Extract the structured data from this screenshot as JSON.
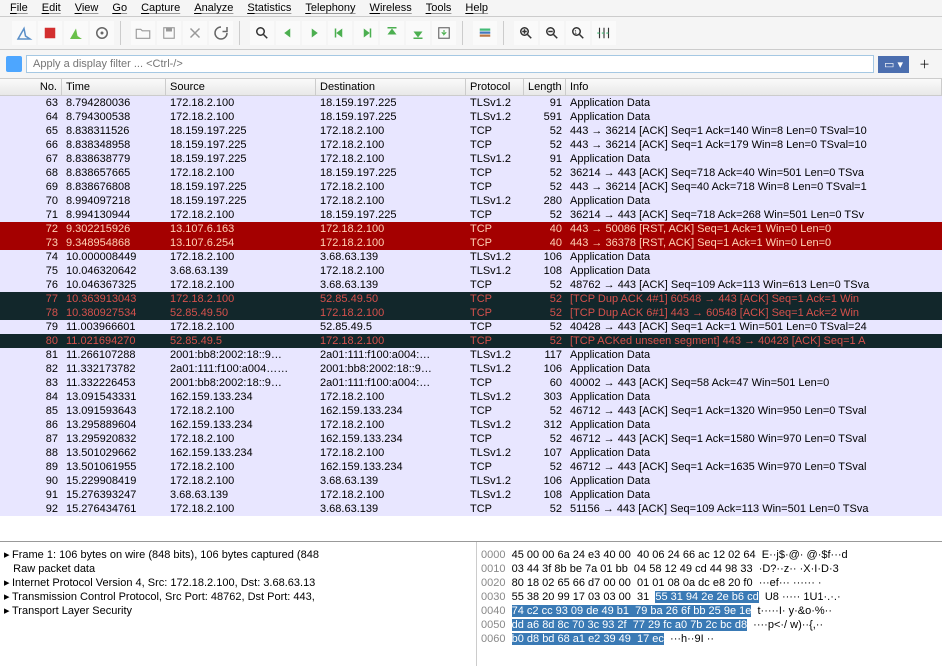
{
  "menu": [
    "File",
    "Edit",
    "View",
    "Go",
    "Capture",
    "Analyze",
    "Statistics",
    "Telephony",
    "Wireless",
    "Tools",
    "Help"
  ],
  "filter": {
    "placeholder": "Apply a display filter ... <Ctrl-/>"
  },
  "columns": {
    "no": "No.",
    "time": "Time",
    "src": "Source",
    "dst": "Destination",
    "proto": "Protocol",
    "len": "Length",
    "info": "Info"
  },
  "rows": [
    {
      "no": "63",
      "t": "8.794280036",
      "s": "172.18.2.100",
      "d": "18.159.197.225",
      "p": "TLSv1.2",
      "l": "91",
      "i": "Application Data",
      "bg": "lightblue"
    },
    {
      "no": "64",
      "t": "8.794300538",
      "s": "172.18.2.100",
      "d": "18.159.197.225",
      "p": "TLSv1.2",
      "l": "591",
      "i": "Application Data",
      "bg": "lightblue"
    },
    {
      "no": "65",
      "t": "8.838311526",
      "s": "18.159.197.225",
      "d": "172.18.2.100",
      "p": "TCP",
      "l": "52",
      "i": "443 → 36214 [ACK] Seq=1 Ack=140 Win=8 Len=0 TSval=10",
      "bg": "lightblue"
    },
    {
      "no": "66",
      "t": "8.838348958",
      "s": "18.159.197.225",
      "d": "172.18.2.100",
      "p": "TCP",
      "l": "52",
      "i": "443 → 36214 [ACK] Seq=1 Ack=179 Win=8 Len=0 TSval=10",
      "bg": "lightblue"
    },
    {
      "no": "67",
      "t": "8.838638779",
      "s": "18.159.197.225",
      "d": "172.18.2.100",
      "p": "TLSv1.2",
      "l": "91",
      "i": "Application Data",
      "bg": "lightblue"
    },
    {
      "no": "68",
      "t": "8.838657665",
      "s": "172.18.2.100",
      "d": "18.159.197.225",
      "p": "TCP",
      "l": "52",
      "i": "36214 → 443 [ACK] Seq=718 Ack=40 Win=501 Len=0 TSva",
      "bg": "lightblue"
    },
    {
      "no": "69",
      "t": "8.838676808",
      "s": "18.159.197.225",
      "d": "172.18.2.100",
      "p": "TCP",
      "l": "52",
      "i": "443 → 36214 [ACK] Seq=40 Ack=718 Win=8 Len=0 TSval=1",
      "bg": "lightblue"
    },
    {
      "no": "70",
      "t": "8.994097218",
      "s": "18.159.197.225",
      "d": "172.18.2.100",
      "p": "TLSv1.2",
      "l": "280",
      "i": "Application Data",
      "bg": "lightblue"
    },
    {
      "no": "71",
      "t": "8.994130944",
      "s": "172.18.2.100",
      "d": "18.159.197.225",
      "p": "TCP",
      "l": "52",
      "i": "36214 → 443 [ACK] Seq=718 Ack=268 Win=501 Len=0 TSv",
      "bg": "lightblue"
    },
    {
      "no": "72",
      "t": "9.302215926",
      "s": "13.107.6.163",
      "d": "172.18.2.100",
      "p": "TCP",
      "l": "40",
      "i": "443 → 50086 [RST, ACK] Seq=1 Ack=1 Win=0 Len=0",
      "bg": "red"
    },
    {
      "no": "73",
      "t": "9.348954868",
      "s": "13.107.6.254",
      "d": "172.18.2.100",
      "p": "TCP",
      "l": "40",
      "i": "443 → 36378 [RST, ACK] Seq=1 Ack=1 Win=0 Len=0",
      "bg": "red"
    },
    {
      "no": "74",
      "t": "10.000008449",
      "s": "172.18.2.100",
      "d": "3.68.63.139",
      "p": "TLSv1.2",
      "l": "106",
      "i": "Application Data",
      "bg": "lightblue"
    },
    {
      "no": "75",
      "t": "10.046320642",
      "s": "3.68.63.139",
      "d": "172.18.2.100",
      "p": "TLSv1.2",
      "l": "108",
      "i": "Application Data",
      "bg": "lightblue"
    },
    {
      "no": "76",
      "t": "10.046367325",
      "s": "172.18.2.100",
      "d": "3.68.63.139",
      "p": "TCP",
      "l": "52",
      "i": "48762 → 443 [ACK] Seq=109 Ack=113 Win=613 Len=0 TSva",
      "bg": "lightblue"
    },
    {
      "no": "77",
      "t": "10.363913043",
      "s": "172.18.2.100",
      "d": "52.85.49.50",
      "p": "TCP",
      "l": "52",
      "i": "[TCP Dup ACK 4#1] 60548 → 443 [ACK] Seq=1 Ack=1 Win",
      "bg": "black"
    },
    {
      "no": "78",
      "t": "10.380927534",
      "s": "52.85.49.50",
      "d": "172.18.2.100",
      "p": "TCP",
      "l": "52",
      "i": "[TCP Dup ACK 6#1] 443 → 60548 [ACK] Seq=1 Ack=2 Win",
      "bg": "black"
    },
    {
      "no": "79",
      "t": "11.003966601",
      "s": "172.18.2.100",
      "d": "52.85.49.5",
      "p": "TCP",
      "l": "52",
      "i": "40428 → 443 [ACK] Seq=1 Ack=1 Win=501 Len=0 TSval=24",
      "bg": "lightblue"
    },
    {
      "no": "80",
      "t": "11.021694270",
      "s": "52.85.49.5",
      "d": "172.18.2.100",
      "p": "TCP",
      "l": "52",
      "i": "[TCP ACKed unseen segment] 443 → 40428 [ACK] Seq=1 A",
      "bg": "black"
    },
    {
      "no": "81",
      "t": "11.266107288",
      "s": "2001:bb8:2002:18::9…",
      "d": "2a01:111:f100:a004:…",
      "p": "TLSv1.2",
      "l": "117",
      "i": "Application Data",
      "bg": "lightblue"
    },
    {
      "no": "82",
      "t": "11.332173782",
      "s": "2a01:111:f100:a004……",
      "d": "2001:bb8:2002:18::9…",
      "p": "TLSv1.2",
      "l": "106",
      "i": "Application Data",
      "bg": "lightblue"
    },
    {
      "no": "83",
      "t": "11.332226453",
      "s": "2001:bb8:2002:18::9…",
      "d": "2a01:111:f100:a004:…",
      "p": "TCP",
      "l": "60",
      "i": "40002 → 443 [ACK] Seq=58 Ack=47 Win=501 Len=0",
      "bg": "lightblue"
    },
    {
      "no": "84",
      "t": "13.091543331",
      "s": "162.159.133.234",
      "d": "172.18.2.100",
      "p": "TLSv1.2",
      "l": "303",
      "i": "Application Data",
      "bg": "lightblue"
    },
    {
      "no": "85",
      "t": "13.091593643",
      "s": "172.18.2.100",
      "d": "162.159.133.234",
      "p": "TCP",
      "l": "52",
      "i": "46712 → 443 [ACK] Seq=1 Ack=1320 Win=950 Len=0 TSval",
      "bg": "lightblue"
    },
    {
      "no": "86",
      "t": "13.295889604",
      "s": "162.159.133.234",
      "d": "172.18.2.100",
      "p": "TLSv1.2",
      "l": "312",
      "i": "Application Data",
      "bg": "lightblue"
    },
    {
      "no": "87",
      "t": "13.295920832",
      "s": "172.18.2.100",
      "d": "162.159.133.234",
      "p": "TCP",
      "l": "52",
      "i": "46712 → 443 [ACK] Seq=1 Ack=1580 Win=970 Len=0 TSval",
      "bg": "lightblue"
    },
    {
      "no": "88",
      "t": "13.501029662",
      "s": "162.159.133.234",
      "d": "172.18.2.100",
      "p": "TLSv1.2",
      "l": "107",
      "i": "Application Data",
      "bg": "lightblue"
    },
    {
      "no": "89",
      "t": "13.501061955",
      "s": "172.18.2.100",
      "d": "162.159.133.234",
      "p": "TCP",
      "l": "52",
      "i": "46712 → 443 [ACK] Seq=1 Ack=1635 Win=970 Len=0 TSval",
      "bg": "lightblue"
    },
    {
      "no": "90",
      "t": "15.229908419",
      "s": "172.18.2.100",
      "d": "3.68.63.139",
      "p": "TLSv1.2",
      "l": "106",
      "i": "Application Data",
      "bg": "lightblue"
    },
    {
      "no": "91",
      "t": "15.276393247",
      "s": "3.68.63.139",
      "d": "172.18.2.100",
      "p": "TLSv1.2",
      "l": "108",
      "i": "Application Data",
      "bg": "lightblue"
    },
    {
      "no": "92",
      "t": "15.276434761",
      "s": "172.18.2.100",
      "d": "3.68.63.139",
      "p": "TCP",
      "l": "52",
      "i": "51156 → 443 [ACK] Seq=109 Ack=113 Win=501 Len=0 TSva",
      "bg": "lightblue"
    }
  ],
  "tree": [
    "Frame 1: 106 bytes on wire (848 bits), 106 bytes captured (848",
    "Raw packet data",
    "Internet Protocol Version 4, Src: 172.18.2.100, Dst: 3.68.63.13",
    "Transmission Control Protocol, Src Port: 48762, Dst Port: 443,",
    "Transport Layer Security"
  ],
  "hex": [
    {
      "off": "0000",
      "b": "45 00 00 6a 24 e3 40 00  40 06 24 66 ac 12 02 64",
      "a": "E··j$·@· @·$f···d"
    },
    {
      "off": "0010",
      "b": "03 44 3f 8b be 7a 01 bb  04 58 12 49 cd 44 98 33",
      "a": "·D?··z·· ·X·I·D·3"
    },
    {
      "off": "0020",
      "b": "80 18 02 65 66 d7 00 00  01 01 08 0a dc e8 20 f0",
      "a": "···ef··· ······ ·"
    },
    {
      "off": "0030",
      "b": "55 38 20 99 17 03 03 00  31 ",
      "sel": "55 31 94 2e 2e b6 cd",
      "a": "U8 ····· 1U1·.·.·"
    },
    {
      "off": "0040",
      "b": "",
      "sel": "74 c2 cc 93 09 de 49 b1  79 ba 26 6f bb 25 9e 1e",
      "a": "t·····I· y·&o·%··"
    },
    {
      "off": "0050",
      "b": "",
      "sel": "dd a6 8d 8c 70 3c 93 2f  77 29 fc a0 7b 2c bc d8",
      "a": "····p<·/ w)··{,··"
    },
    {
      "off": "0060",
      "b": "",
      "sel": "b0 d8 bd 68 a1 e2 39 49  17 ec",
      "a": "···h··9I ··"
    }
  ]
}
